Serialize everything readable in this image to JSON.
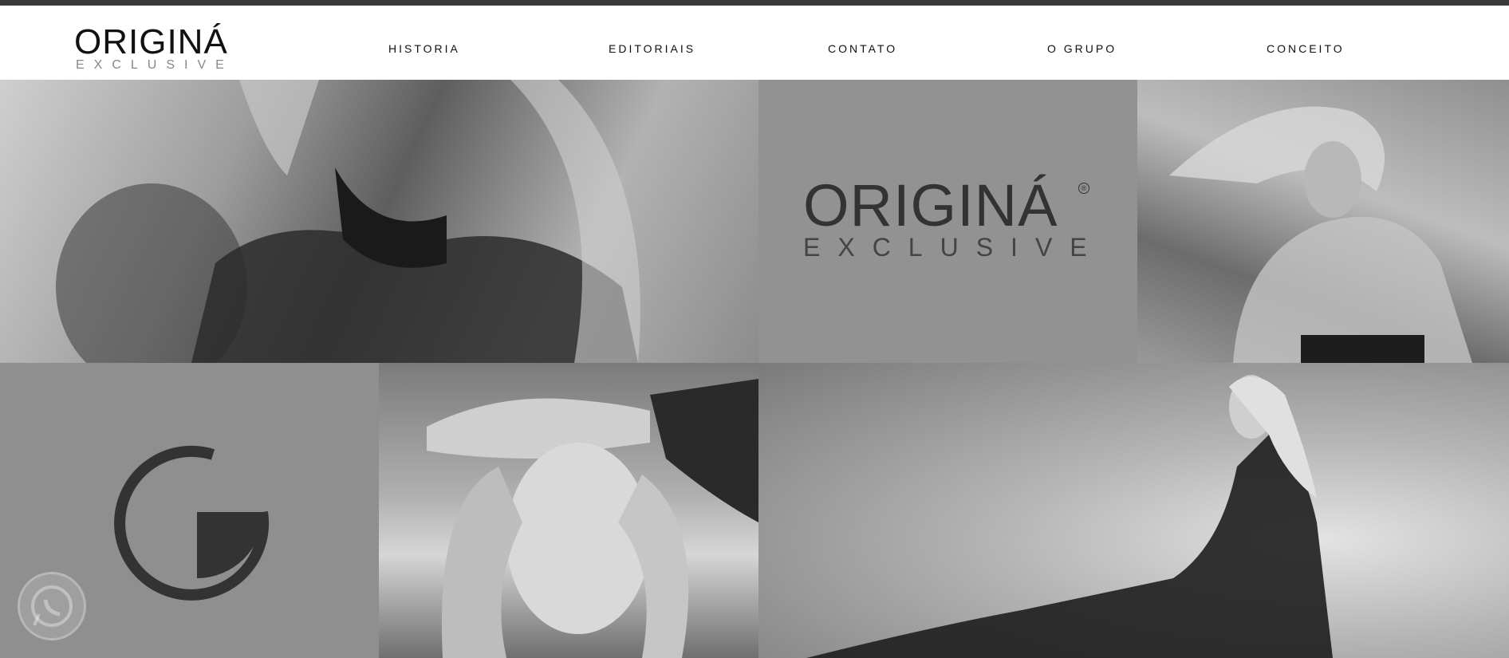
{
  "header": {
    "logo_main": "ORIGINÁ",
    "logo_sub": "EXCLUSIVE"
  },
  "nav": {
    "items": [
      "HISTORIA",
      "EDITORIAIS",
      "CONTATO",
      "O GRUPO",
      "CONCEITO"
    ]
  },
  "tiles": {
    "brand_main": "ORIGINÁ",
    "brand_sub": "EXCLUSIVE",
    "reg_mark": "®"
  },
  "colors": {
    "topbar": "#3a3a3a",
    "tile_gray": "#929292",
    "logo_dark": "#333333"
  },
  "icons": {
    "whatsapp": "whatsapp-icon"
  }
}
